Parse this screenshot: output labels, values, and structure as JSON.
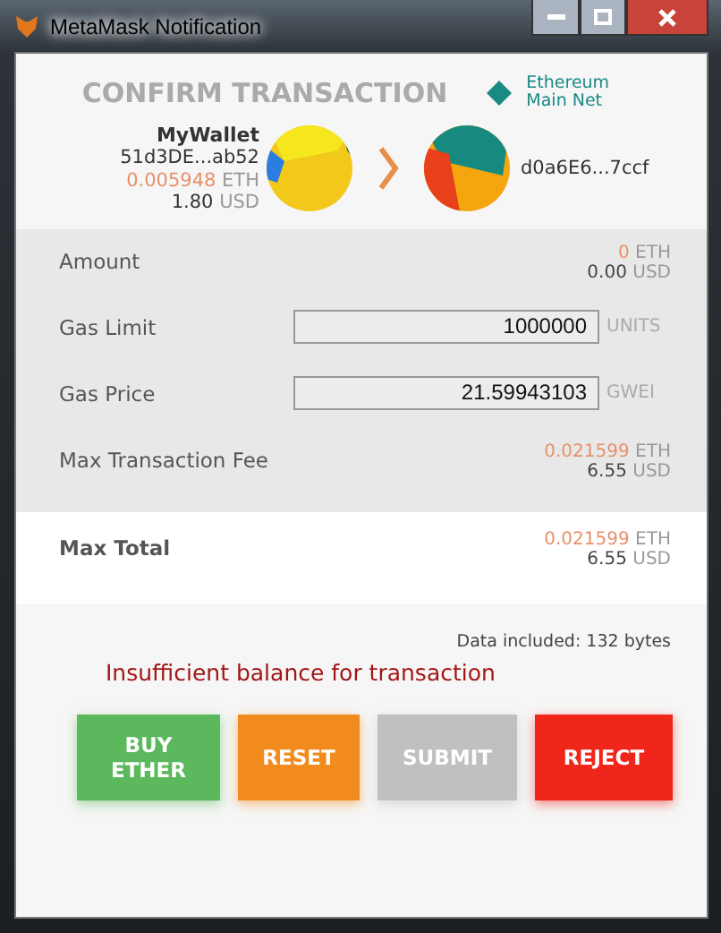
{
  "window": {
    "title": "MetaMask Notification"
  },
  "header": {
    "title": "CONFIRM TRANSACTION",
    "network": {
      "label": "Ethereum Main Net",
      "color": "#1a8a84"
    }
  },
  "sender": {
    "name": "MyWallet",
    "address": "51d3DE...ab52",
    "eth": "0.005948",
    "eth_unit": "ETH",
    "usd": "1.80",
    "usd_unit": "USD"
  },
  "recipient": {
    "address": "d0a6E6...7ccf"
  },
  "details": [
    {
      "kind": "amount",
      "label": "Amount",
      "eth": "0",
      "eth_unit": "ETH",
      "usd": "0.00",
      "usd_unit": "USD"
    },
    {
      "kind": "input",
      "label": "Gas Limit",
      "value": "1000000",
      "unit": "UNITS"
    },
    {
      "kind": "input",
      "label": "Gas Price",
      "value": "21.59943103",
      "unit": "GWEI"
    },
    {
      "kind": "amount",
      "label": "Max Transaction Fee",
      "eth": "0.021599",
      "eth_unit": "ETH",
      "usd": "6.55",
      "usd_unit": "USD"
    }
  ],
  "total": {
    "label": "Max Total",
    "eth": "0.021599",
    "eth_unit": "ETH",
    "usd": "6.55",
    "usd_unit": "USD"
  },
  "data_included": "Data included: 132 bytes",
  "error": "Insufficient balance for transaction",
  "buttons": [
    {
      "label": "BUY ETHER",
      "color": "#5cb85c"
    },
    {
      "label": "RESET",
      "color": "#f28b1e"
    },
    {
      "label": "SUBMIT",
      "color": "#c0c0c0"
    },
    {
      "label": "REJECT",
      "color": "#f0261a"
    }
  ]
}
